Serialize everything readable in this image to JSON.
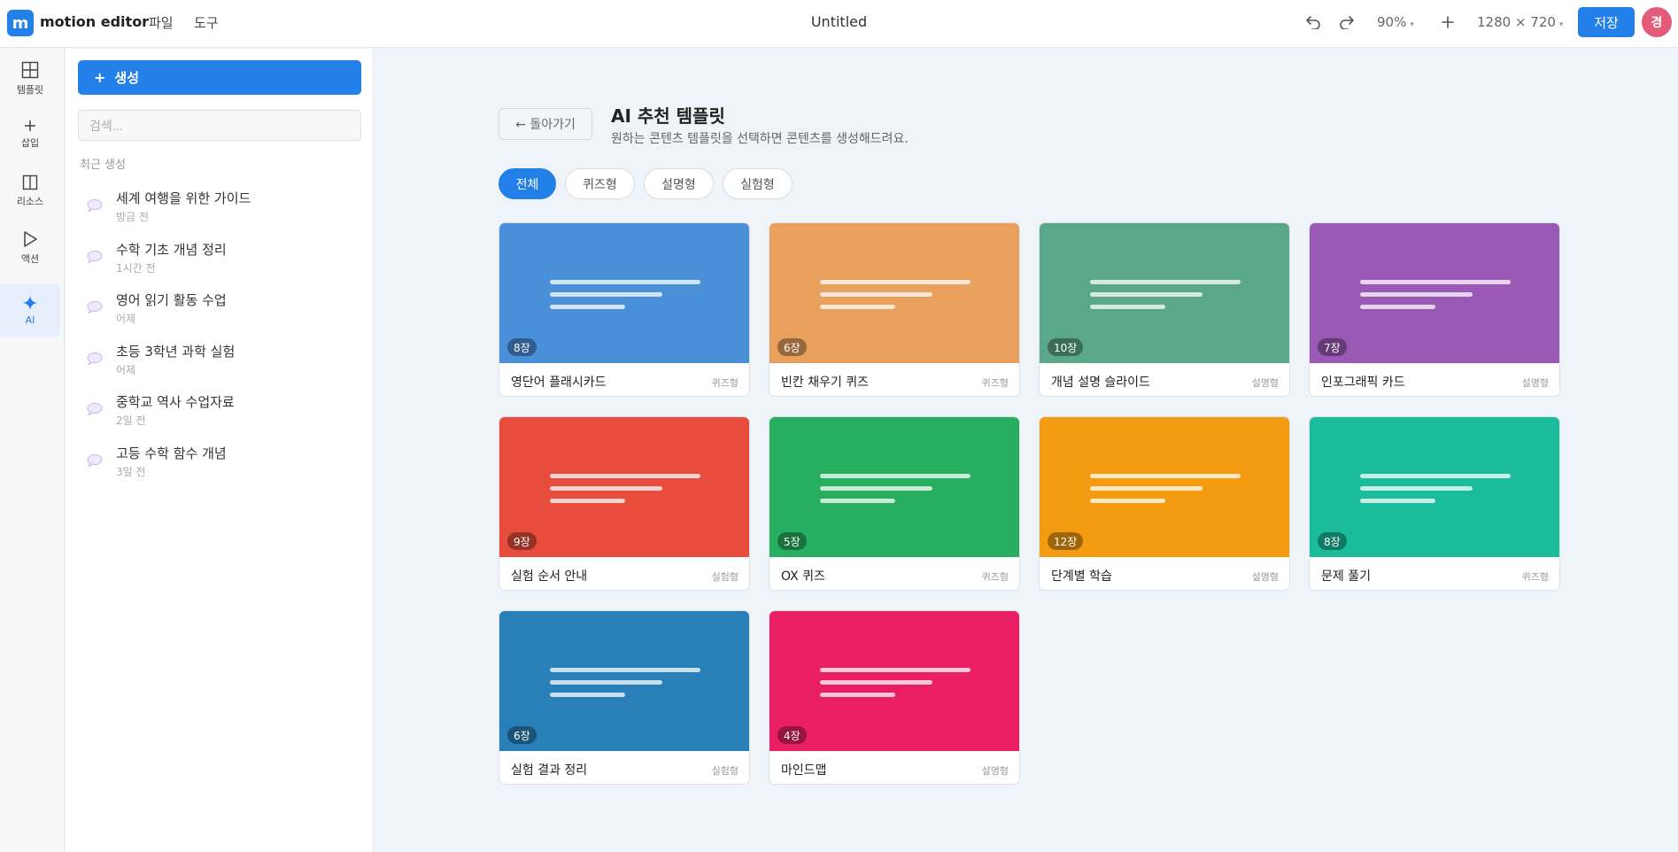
{
  "header": {
    "logo_letter": "m",
    "app_name": "motion editor",
    "menus": [
      "파일",
      "도구"
    ],
    "doc_title": "Untitled",
    "zoom": "90%",
    "canvas_size": "1280 × 720",
    "save_label": "저장",
    "avatar_letter": "경"
  },
  "rail": {
    "items": [
      {
        "label": "템플릿",
        "icon": "grid-icon"
      },
      {
        "label": "삽입",
        "icon": "plus-icon"
      },
      {
        "label": "리소스",
        "icon": "columns-icon"
      },
      {
        "label": "액션",
        "icon": "play-icon"
      },
      {
        "label": "AI",
        "icon": "sparkle-icon"
      }
    ]
  },
  "panel": {
    "create_label": "생성",
    "search_placeholder": "검색...",
    "recent_title": "최근 생성",
    "recent": [
      {
        "title": "세계 여행을 위한 가이드",
        "time": "방금 전"
      },
      {
        "title": "수학 기초 개념 정리",
        "time": "1시간 전"
      },
      {
        "title": "영어 읽기 활동 수업",
        "time": "어제"
      },
      {
        "title": "초등 3학년 과학 실험",
        "time": "어제"
      },
      {
        "title": "중학교 역사 수업자료",
        "time": "2일 전"
      },
      {
        "title": "고등 수학 함수 개념",
        "time": "3일 전"
      }
    ]
  },
  "main": {
    "back_label": "← 돌아가기",
    "title": "AI 추천 템플릿",
    "subtitle": "원하는 콘텐츠 템플릿을 선택하면 콘텐츠를 생성해드려요.",
    "filters": [
      "전체",
      "퀴즈형",
      "설명형",
      "실험형"
    ],
    "templates": [
      {
        "name": "영단어 플래시카드",
        "type": "퀴즈형",
        "count": "8장",
        "color": "#4a90d9"
      },
      {
        "name": "빈칸 채우기 퀴즈",
        "type": "퀴즈형",
        "count": "6장",
        "color": "#e8a05c"
      },
      {
        "name": "개념 설명 슬라이드",
        "type": "설명형",
        "count": "10장",
        "color": "#5aa889"
      },
      {
        "name": "인포그래픽 카드",
        "type": "설명형",
        "count": "7장",
        "color": "#9b59b6"
      },
      {
        "name": "실험 순서 안내",
        "type": "실험형",
        "count": "9장",
        "color": "#e74c3c"
      },
      {
        "name": "OX 퀴즈",
        "type": "퀴즈형",
        "count": "5장",
        "color": "#27ae60"
      },
      {
        "name": "단계별 학습",
        "type": "설명형",
        "count": "12장",
        "color": "#f39c12"
      },
      {
        "name": "문제 풀기",
        "type": "퀴즈형",
        "count": "8장",
        "color": "#1abc9c"
      },
      {
        "name": "실험 결과 정리",
        "type": "실험형",
        "count": "6장",
        "color": "#2980b9"
      },
      {
        "name": "마인드맵",
        "type": "설명형",
        "count": "4장",
        "color": "#e91e63"
      }
    ]
  }
}
